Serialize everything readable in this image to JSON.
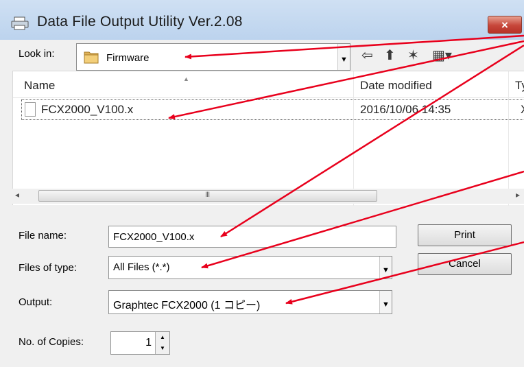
{
  "window": {
    "title": "Data File Output Utility Ver.2.08",
    "close_label": "×"
  },
  "look_in": {
    "label": "Look in:",
    "value": "Firmware"
  },
  "toolbar": {
    "back_icon": "⇦",
    "up_icon": "⬆",
    "newfolder_icon": "✶",
    "views_icon": "▦▾"
  },
  "file_list": {
    "columns": [
      "Name",
      "Date modified",
      "Ty"
    ],
    "rows": [
      {
        "name": "FCX2000_V100.x",
        "date": "2016/10/06 14:35",
        "type": "X"
      }
    ]
  },
  "scrollbar": {
    "left_arrow": "◂",
    "right_arrow": "▸",
    "grip": "III"
  },
  "file_name": {
    "label": "File name:",
    "value": "FCX2000_V100.x"
  },
  "file_type": {
    "label": "Files of type:",
    "value": "All Files (*.*)"
  },
  "output": {
    "label": "Output:",
    "value": "Graphtec FCX2000 (1 コピー)"
  },
  "copies": {
    "label": "No. of Copies:",
    "value": "1"
  },
  "buttons": {
    "print": "Print",
    "cancel": "Cancel"
  },
  "annotation_color": "#e8001c"
}
